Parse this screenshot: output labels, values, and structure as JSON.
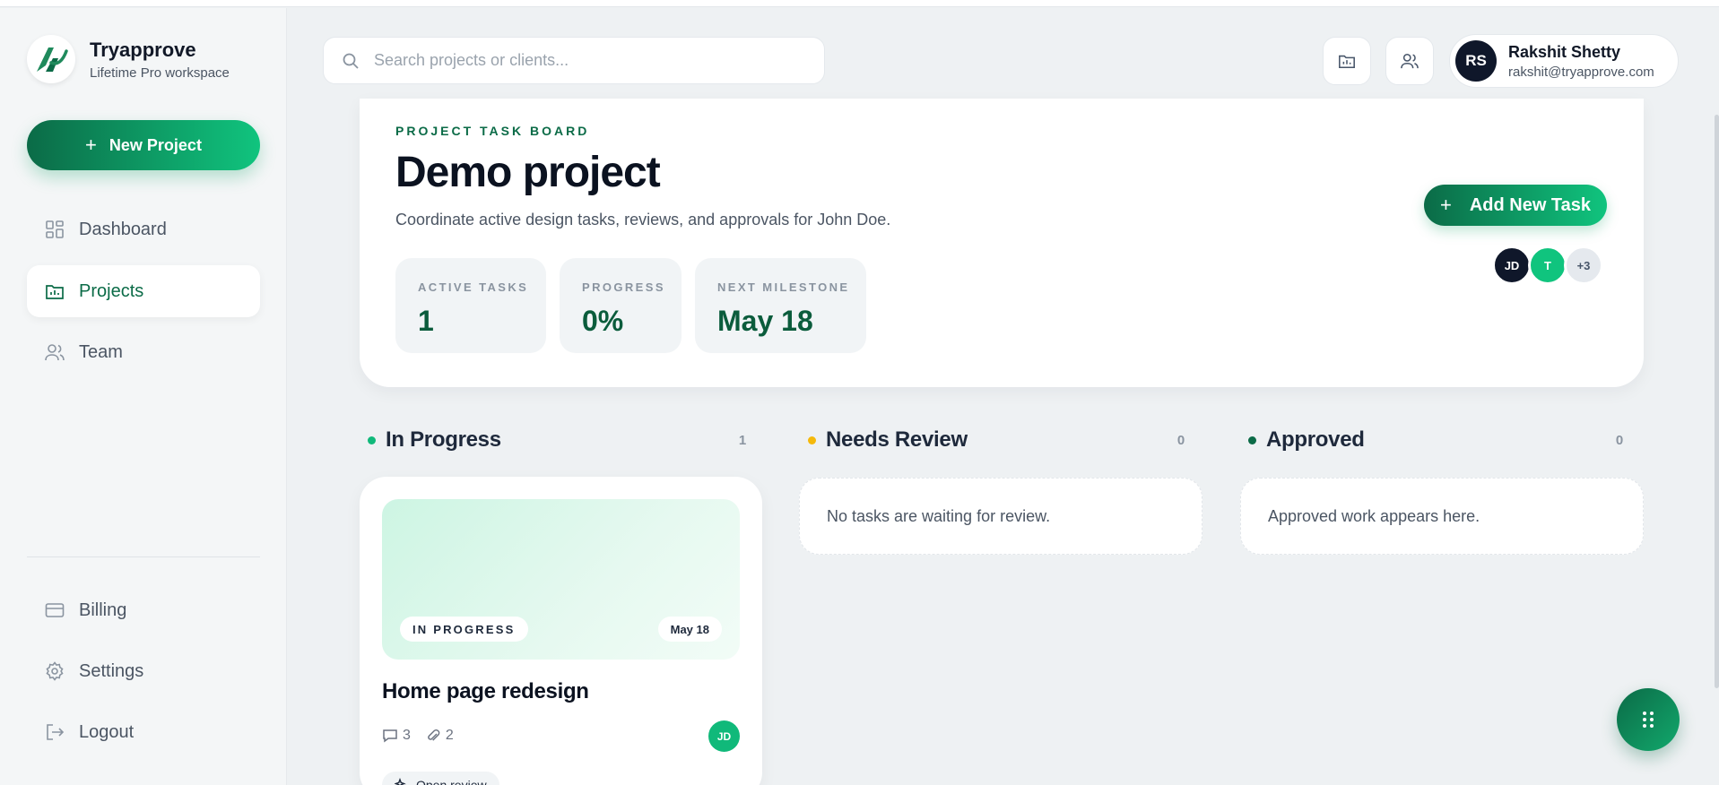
{
  "brand": {
    "name": "Tryapprove",
    "subtitle": "Lifetime Pro workspace"
  },
  "sidebar": {
    "new_project_label": "New Project",
    "items": [
      {
        "label": "Dashboard",
        "icon": "dashboard-icon",
        "active": false
      },
      {
        "label": "Projects",
        "icon": "folder-icon",
        "active": true
      },
      {
        "label": "Team",
        "icon": "team-icon",
        "active": false
      }
    ],
    "bottom_items": [
      {
        "label": "Billing",
        "icon": "credit-card-icon"
      },
      {
        "label": "Settings",
        "icon": "gear-icon"
      },
      {
        "label": "Logout",
        "icon": "logout-icon"
      }
    ]
  },
  "header": {
    "search_placeholder": "Search projects or clients...",
    "user": {
      "initials": "RS",
      "name": "Rakshit Shetty",
      "email": "rakshit@tryapprove.com"
    }
  },
  "project": {
    "eyebrow": "PROJECT TASK BOARD",
    "title": "Demo project",
    "description": "Coordinate active design tasks, reviews, and approvals for John Doe.",
    "add_task_label": "Add New Task",
    "stats": [
      {
        "label": "ACTIVE TASKS",
        "value": "1"
      },
      {
        "label": "PROGRESS",
        "value": "0%"
      },
      {
        "label": "NEXT MILESTONE",
        "value": "May 18"
      }
    ],
    "members": [
      {
        "initials": "JD",
        "color": "#0f172a",
        "text_color": "#ffffff"
      },
      {
        "initials": "T",
        "color": "#10c47e",
        "text_color": "#ffffff"
      },
      {
        "initials": "+3",
        "color": "#e5e9ee",
        "text_color": "#475569"
      }
    ]
  },
  "board": {
    "columns": [
      {
        "title": "In Progress",
        "count": "1",
        "dot_color": "#10b97a"
      },
      {
        "title": "Needs Review",
        "count": "0",
        "dot_color": "#f5b90b",
        "empty_text": "No tasks are waiting for review."
      },
      {
        "title": "Approved",
        "count": "0",
        "dot_color": "#0b6b47",
        "empty_text": "Approved work appears here."
      }
    ],
    "task": {
      "status": "IN PROGRESS",
      "date": "May 18",
      "title": "Home page redesign",
      "comments": "3",
      "attachments": "2",
      "assignee": "JD",
      "action_label": "Open review"
    }
  },
  "colors": {
    "brand_dark": "#0b6b47",
    "brand_light": "#10c47e",
    "background": "#eef1f3"
  }
}
